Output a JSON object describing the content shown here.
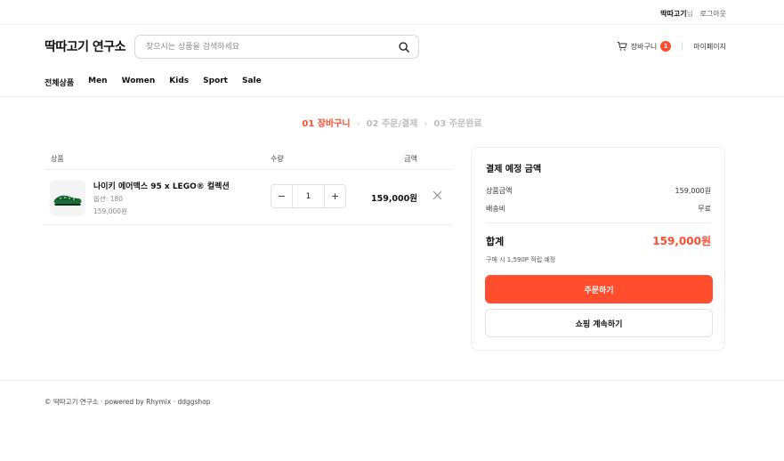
{
  "topbar": {
    "user_name": "딱따고기",
    "user_suffix": "님",
    "logout": "로그아웃"
  },
  "header": {
    "brand": "딱따고기 연구소",
    "search_placeholder": "찾으시는 상품을 검색하세요",
    "cart_label": "장바구니",
    "cart_count": "1",
    "mypage": "마이페이지"
  },
  "nav": {
    "items": [
      {
        "label": "전체상품"
      },
      {
        "label": "Men"
      },
      {
        "label": "Women"
      },
      {
        "label": "Kids"
      },
      {
        "label": "Sport"
      },
      {
        "label": "Sale"
      }
    ]
  },
  "steps": {
    "items": [
      {
        "label": "01 장바구니",
        "active": true
      },
      {
        "label": "02 주문/결제",
        "active": false
      },
      {
        "label": "03 주문완료",
        "active": false
      }
    ],
    "separator": "›"
  },
  "cart": {
    "headers": {
      "product": "상품",
      "quantity": "수량",
      "amount": "금액"
    },
    "items": [
      {
        "name": "나이키 에어맥스 95 x LEGO® 컬렉션",
        "option": "옵션: 180",
        "unit_price": "159,000원",
        "quantity": "1",
        "total": "159,000원"
      }
    ],
    "minus": "−",
    "plus": "+"
  },
  "summary": {
    "title": "결제 예정 금액",
    "subtotal_label": "상품금액",
    "subtotal_value": "159,000원",
    "shipping_label": "배송비",
    "shipping_value": "무료",
    "total_label": "합계",
    "total_value": "159,000원",
    "points_note": "구매 시 1,590P 적립 예정",
    "order_button": "주문하기",
    "continue_button": "쇼핑 계속하기"
  },
  "colors": {
    "accent": "#ff4d2e",
    "text": "#111111",
    "muted": "#888888",
    "border": "#ececec"
  },
  "icons": {
    "search": "search-icon",
    "cart": "cart-icon",
    "remove": "close-icon"
  },
  "footer": {
    "text": "© 딱따고기 연구소 · powered by Rhymix · ddggshop"
  }
}
